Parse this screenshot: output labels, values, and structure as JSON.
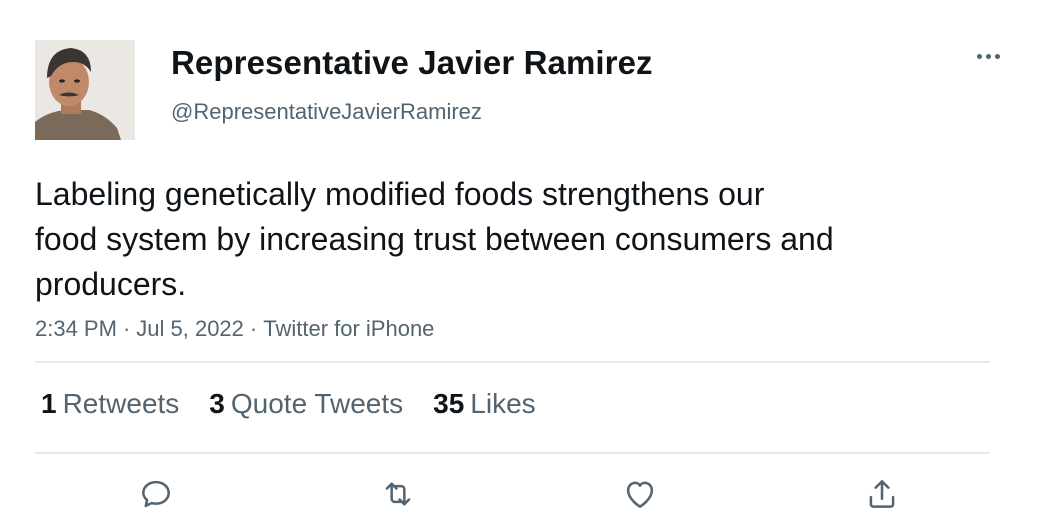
{
  "author": {
    "display_name": "Representative Javier Ramirez",
    "handle": "@RepresentativeJavierRamirez"
  },
  "tweet": {
    "text_lines": [
      "Labeling genetically modified foods strengthens our",
      "food system by increasing trust between consumers and",
      "producers."
    ],
    "time": "2:34 PM",
    "date": "Jul 5, 2022",
    "source": "Twitter for iPhone",
    "separator": "·"
  },
  "stats": {
    "retweets": {
      "count": "1",
      "label": "Retweets"
    },
    "quote_tweets": {
      "count": "3",
      "label": "Quote Tweets"
    },
    "likes": {
      "count": "35",
      "label": "Likes"
    }
  },
  "actions": {
    "reply": "reply-icon",
    "retweet": "retweet-icon",
    "like": "heart-icon",
    "share": "share-icon"
  },
  "colors": {
    "text": "#0f1419",
    "secondary": "#536471",
    "divider": "#e6e9eb"
  }
}
